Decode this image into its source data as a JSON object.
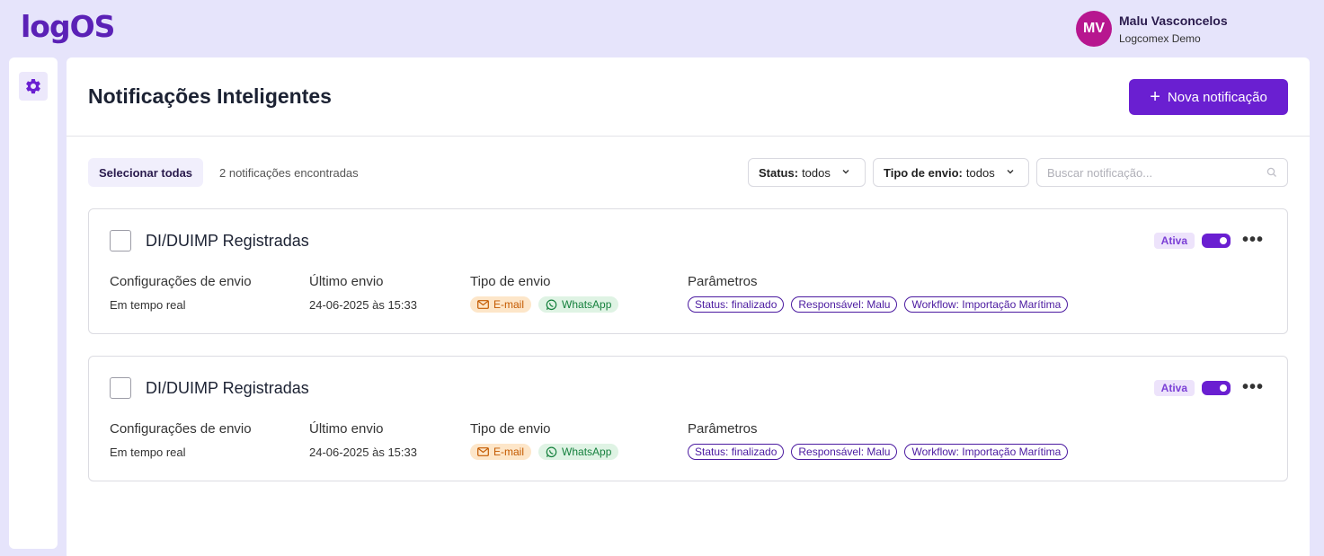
{
  "app": {
    "logo": "logOS"
  },
  "user": {
    "initials": "MV",
    "name": "Malu Vasconcelos",
    "org": "Logcomex Demo"
  },
  "sidebar": {
    "items": [
      {
        "icon": "gear-icon",
        "active": true
      }
    ]
  },
  "page": {
    "title": "Notificações Inteligentes",
    "new_button": "Nova notificação"
  },
  "toolbar": {
    "select_all": "Selecionar todas",
    "found": "2 notificações encontradas",
    "filters": [
      {
        "label": "Status:",
        "value": "todos"
      },
      {
        "label": "Tipo de envio:",
        "value": "todos"
      }
    ],
    "search_placeholder": "Buscar notificação..."
  },
  "labels": {
    "config": "Configurações de envio",
    "last_send": "Último envio",
    "send_type": "Tipo de envio",
    "params": "Parâmetros"
  },
  "notifications": [
    {
      "title": "DI/DUIMP Registradas",
      "status": "Ativa",
      "enabled": true,
      "config": "Em tempo real",
      "last_send": "24-06-2025 às 15:33",
      "channels": [
        "E-mail",
        "WhatsApp"
      ],
      "params": [
        "Status: finalizado",
        "Responsável: Malu",
        "Workflow: Importação Marítima"
      ]
    },
    {
      "title": "DI/DUIMP Registradas",
      "status": "Ativa",
      "enabled": true,
      "config": "Em tempo real",
      "last_send": "24-06-2025 às 15:33",
      "channels": [
        "E-mail",
        "WhatsApp"
      ],
      "params": [
        "Status: finalizado",
        "Responsável: Malu",
        "Workflow: Importação Marítima"
      ]
    }
  ],
  "colors": {
    "brand": "#6a1fd1",
    "avatar": "#b7168f",
    "background": "#e6e4fb"
  }
}
